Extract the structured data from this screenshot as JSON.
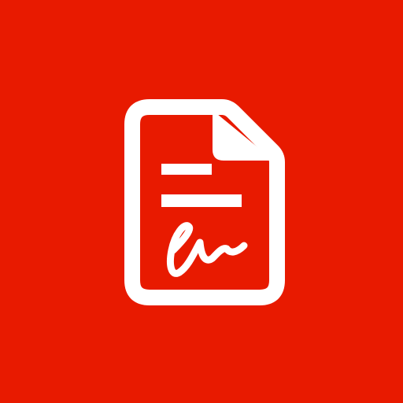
{
  "app_icon": {
    "icon": "signed-document-icon",
    "background_color": "#E81A00",
    "foreground_color": "#FFFFFF",
    "parts": {
      "outline": "document-outline",
      "fold": "page-corner-fold",
      "text_lines": [
        "short-text-line",
        "long-text-line"
      ],
      "signature": "signature-scribble"
    }
  }
}
